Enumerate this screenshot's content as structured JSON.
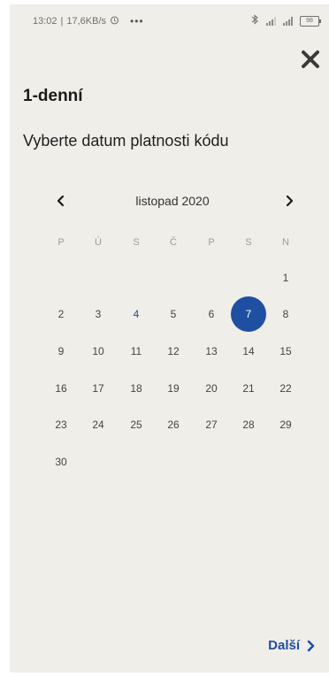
{
  "status_bar": {
    "time": "13:02",
    "speed": "17,6KB/s",
    "more": "•••",
    "battery": "98"
  },
  "header": {
    "title": "1-denní",
    "subtitle": "Vyberte datum platnosti kódu"
  },
  "calendar": {
    "month_label": "listopad 2020",
    "weekdays": [
      "P",
      "Ú",
      "S",
      "Č",
      "P",
      "S",
      "N"
    ],
    "today": "4",
    "selected": "7",
    "days": [
      "1",
      "2",
      "3",
      "4",
      "5",
      "6",
      "7",
      "8",
      "9",
      "10",
      "11",
      "12",
      "13",
      "14",
      "15",
      "16",
      "17",
      "18",
      "19",
      "20",
      "21",
      "22",
      "23",
      "24",
      "25",
      "26",
      "27",
      "28",
      "29",
      "30"
    ]
  },
  "footer": {
    "next_label": "Další"
  },
  "colors": {
    "accent": "#1f4fa0",
    "background": "#efeee9"
  }
}
